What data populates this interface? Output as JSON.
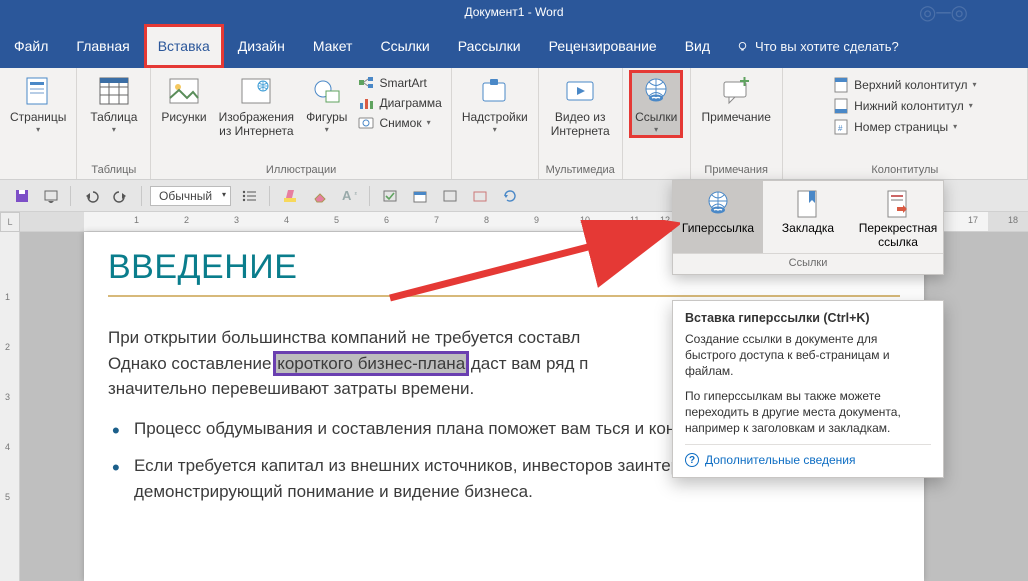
{
  "title": "Документ1 - Word",
  "tabs": {
    "file": "Файл",
    "home": "Главная",
    "insert": "Вставка",
    "design": "Дизайн",
    "layout": "Макет",
    "references": "Ссылки",
    "mailings": "Рассылки",
    "review": "Рецензирование",
    "view": "Вид"
  },
  "tell_me": "Что вы хотите сделать?",
  "ribbon": {
    "pages": {
      "btn": "Страницы",
      "group": ""
    },
    "tables": {
      "btn": "Таблица",
      "group": "Таблицы"
    },
    "illus": {
      "pics": "Рисунки",
      "online": "Изображения\nиз Интернета",
      "shapes": "Фигуры",
      "smartart": "SmartArt",
      "chart": "Диаграмма",
      "screenshot": "Снимок",
      "group": "Иллюстрации"
    },
    "addins": {
      "btn": "Надстройки",
      "group": ""
    },
    "media": {
      "video": "Видео из\nИнтернета",
      "group": "Мультимедиа"
    },
    "links": {
      "btn": "Ссылки",
      "group": ""
    },
    "comments": {
      "btn": "Примечание",
      "group": "Примечания"
    },
    "hf": {
      "header": "Верхний колонтитул",
      "footer": "Нижний колонтитул",
      "pagenum": "Номер страницы",
      "group": "Колонтитулы"
    }
  },
  "qat": {
    "style": "Обычный"
  },
  "links_popout": {
    "hyperlink": "Гиперссылка",
    "bookmark": "Закладка",
    "crossref": "Перекрестная\nссылка",
    "caption": "Ссылки"
  },
  "tooltip": {
    "title": "Вставка гиперссылки (Ctrl+K)",
    "p1": "Создание ссылки в документе для быстрого доступа к веб-страницам и файлам.",
    "p2": "По гиперссылкам вы также можете переходить в другие места документа, например к заголовкам и закладкам.",
    "more": "Дополнительные сведения"
  },
  "doc": {
    "heading": "ВВЕДЕНИЕ",
    "para_a": "При открытии большинства компаний не требуется составл",
    "para_b": "Однако составление ",
    "para_sel": "короткого бизнес-плана",
    "para_c": " даст вам ряд п",
    "para_d": "значительно перевешивают затраты времени.",
    "bullet1": "Процесс обдумывания и составления плана поможет вам                                              ться и концепцию бизнеса.",
    "bullet2": "Если требуется капитал из внешних источников, инвесторов заинтересует план, демонстрирующий понимание и видение бизнеса."
  },
  "ruler_nums": [
    "1",
    "2",
    "3",
    "4",
    "5",
    "6",
    "7",
    "8",
    "9",
    "10",
    "11",
    "12",
    "17",
    "18"
  ],
  "vruler_nums": [
    "1",
    "2",
    "3",
    "4",
    "5"
  ]
}
